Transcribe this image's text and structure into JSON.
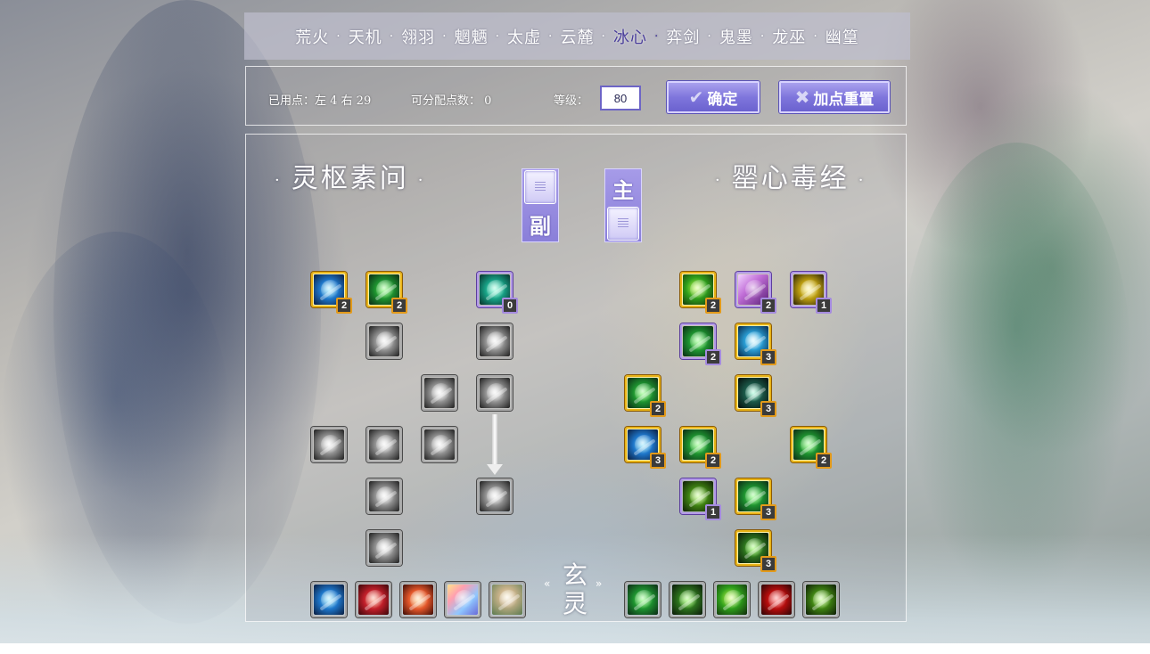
{
  "tabs": [
    {
      "label": "荒火",
      "active": false
    },
    {
      "label": "天机",
      "active": false
    },
    {
      "label": "翎羽",
      "active": false
    },
    {
      "label": "魍魉",
      "active": false
    },
    {
      "label": "太虚",
      "active": false
    },
    {
      "label": "云麓",
      "active": false
    },
    {
      "label": "冰心",
      "active": true
    },
    {
      "label": "弈剑",
      "active": false
    },
    {
      "label": "鬼墨",
      "active": false
    },
    {
      "label": "龙巫",
      "active": false
    },
    {
      "label": "幽篁",
      "active": false
    }
  ],
  "tab_separator": "·",
  "info": {
    "used_points": "已用点：左 4  右 29",
    "available_points": "可分配点数： 0",
    "level_label": "等级：",
    "level_value": "80",
    "confirm_label": "确定",
    "reset_label": "加点重置"
  },
  "left_tree": {
    "title": "灵枢素问",
    "deco": "·"
  },
  "right_tree": {
    "title": "罂心毒经",
    "deco": "·"
  },
  "toggle_left": {
    "label": "副"
  },
  "toggle_right": {
    "label": "主"
  },
  "bottom_label": {
    "char1": "玄",
    "char2": "灵",
    "left_mark": "«",
    "right_mark": "»"
  },
  "colors": {
    "accent": "#7f76dc",
    "gold_frame": "#e9b417",
    "purple_frame": "#b39ae8",
    "active_tab": "#4a3e9a"
  },
  "skills": {
    "left": [
      {
        "id": "l1",
        "icon": "water-spirit-icon",
        "frame": "gold",
        "color": "c-blue",
        "points": "2"
      },
      {
        "id": "l2",
        "icon": "green-hand-icon",
        "frame": "gold",
        "color": "c-green",
        "points": "2"
      },
      {
        "id": "l3",
        "icon": "jade-orbs-icon",
        "frame": "purple",
        "color": "c-teal",
        "points": "0"
      },
      {
        "id": "l4",
        "icon": "meditation-figure-icon",
        "frame": "gray",
        "color": "c-gray",
        "points": ""
      },
      {
        "id": "l5",
        "icon": "withered-tree-icon",
        "frame": "gray",
        "color": "c-gray",
        "points": ""
      },
      {
        "id": "l6",
        "icon": "whirlwind-icon",
        "frame": "gray",
        "color": "c-gray",
        "points": ""
      },
      {
        "id": "l7",
        "icon": "dark-claw-icon",
        "frame": "gray",
        "color": "c-gray",
        "points": ""
      },
      {
        "id": "l8",
        "icon": "sword-strike-icon",
        "frame": "gray",
        "color": "c-gray",
        "points": ""
      },
      {
        "id": "l9",
        "icon": "spirit-shield-icon",
        "frame": "gray",
        "color": "c-gray",
        "points": ""
      },
      {
        "id": "l10",
        "icon": "clover-seal-icon",
        "frame": "gray",
        "color": "c-gray",
        "points": ""
      },
      {
        "id": "l11",
        "icon": "eye-icon",
        "frame": "gray",
        "color": "c-gray",
        "points": ""
      },
      {
        "id": "l12",
        "icon": "helmet-icon",
        "frame": "gray",
        "color": "c-gray",
        "points": ""
      },
      {
        "id": "l13",
        "icon": "feather-wing-icon",
        "frame": "gray",
        "color": "c-gray",
        "points": ""
      }
    ],
    "right": [
      {
        "id": "r1",
        "icon": "lotus-leaf-icon",
        "frame": "gold",
        "color": "c-green2",
        "points": "2"
      },
      {
        "id": "r2",
        "icon": "fan-icon",
        "frame": "purple",
        "color": "c-pink",
        "points": "2"
      },
      {
        "id": "r3",
        "icon": "golden-flame-icon",
        "frame": "purple",
        "color": "c-yellow",
        "points": "1"
      },
      {
        "id": "r4",
        "icon": "poison-claw-icon",
        "frame": "purple",
        "color": "c-green",
        "points": "2"
      },
      {
        "id": "r5",
        "icon": "ice-burst-icon",
        "frame": "gold",
        "color": "c-cyan",
        "points": "3"
      },
      {
        "id": "r6",
        "icon": "green-vortex-icon",
        "frame": "gold",
        "color": "c-green",
        "points": "2"
      },
      {
        "id": "r7",
        "icon": "serpent-icon",
        "frame": "gold",
        "color": "c-blackbronze",
        "points": "3"
      },
      {
        "id": "r8",
        "icon": "blue-crescent-icon",
        "frame": "gold",
        "color": "c-blue",
        "points": "3"
      },
      {
        "id": "r9",
        "icon": "dripping-venom-icon",
        "frame": "gold",
        "color": "c-green",
        "points": "2"
      },
      {
        "id": "r10",
        "icon": "arrow-up-burst-icon",
        "frame": "gold",
        "color": "c-green",
        "points": "2"
      },
      {
        "id": "r11",
        "icon": "vine-slash-icon",
        "frame": "purple",
        "color": "c-olive",
        "points": "1"
      },
      {
        "id": "r12",
        "icon": "poison-mist-icon",
        "frame": "gold",
        "color": "c-green",
        "points": "3"
      },
      {
        "id": "r13",
        "icon": "venom-beast-icon",
        "frame": "gold",
        "color": "c-darkgreen",
        "points": "3"
      }
    ],
    "bottom_left": [
      {
        "id": "bl1",
        "icon": "blue-wave-icon",
        "frame": "gray",
        "color": "c-blue"
      },
      {
        "id": "bl2",
        "icon": "crimson-heart-icon",
        "frame": "gray",
        "color": "c-red"
      },
      {
        "id": "bl3",
        "icon": "fire-flower-icon",
        "frame": "gray",
        "color": "c-orange"
      },
      {
        "id": "bl4",
        "icon": "rainbow-orb-icon",
        "frame": "gray",
        "color": "c-rainbow"
      },
      {
        "id": "bl5",
        "icon": "sage-portrait-icon",
        "frame": "gray",
        "color": "c-portrait"
      }
    ],
    "bottom_right": [
      {
        "id": "br1",
        "icon": "green-explosion-icon",
        "frame": "gray",
        "color": "c-green"
      },
      {
        "id": "br2",
        "icon": "moss-pattern-icon",
        "frame": "gray",
        "color": "c-darkgreen"
      },
      {
        "id": "br3",
        "icon": "jade-beast-icon",
        "frame": "gray",
        "color": "c-green2"
      },
      {
        "id": "br4",
        "icon": "blood-drop-icon",
        "frame": "gray",
        "color": "c-crimson"
      },
      {
        "id": "br5",
        "icon": "vine-swirl-icon",
        "frame": "gray",
        "color": "c-olive"
      }
    ]
  }
}
